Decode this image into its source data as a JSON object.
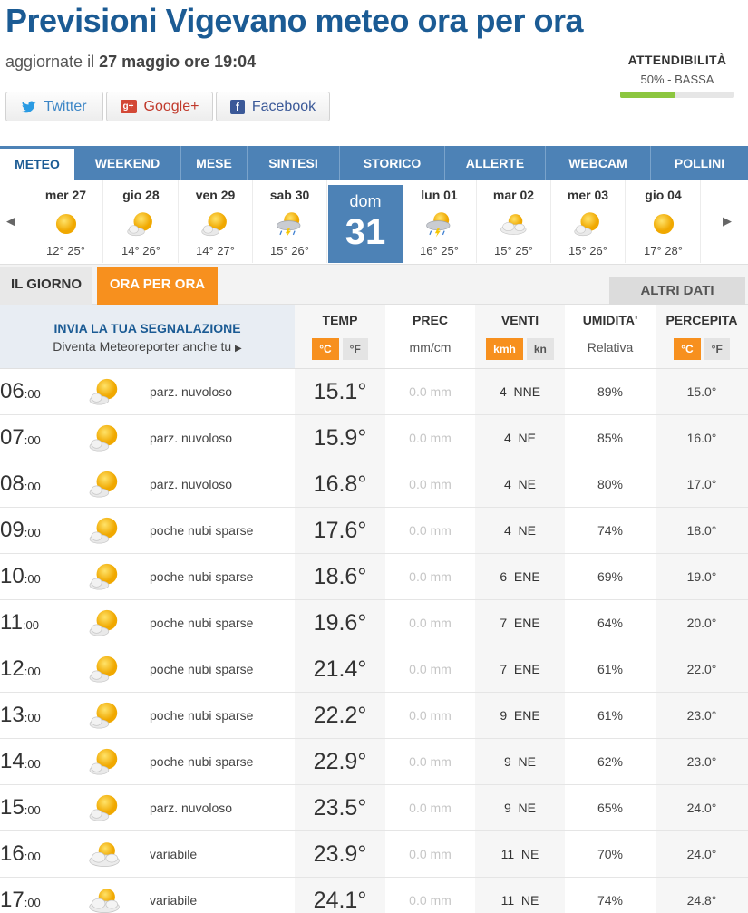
{
  "header": {
    "title": "Previsioni Vigevano meteo ora per ora",
    "updated_prefix": "aggiornate il",
    "updated_date": "27 maggio ore 19:04",
    "reliability_title": "ATTENDIBILITÀ",
    "reliability_value": "50% - BASSA",
    "reliability_fraction": 0.5
  },
  "social": {
    "twitter": "Twitter",
    "google": "Google+",
    "facebook": "Facebook"
  },
  "nav": [
    "METEO",
    "WEEKEND",
    "MESE",
    "SINTESI",
    "STORICO",
    "ALLERTE",
    "WEBCAM",
    "POLLINI"
  ],
  "days": [
    {
      "name": "mer 27",
      "temps": "12° 25°",
      "icon": "sun-icon"
    },
    {
      "name": "gio 28",
      "temps": "14° 26°",
      "icon": "sun-cloud-icon"
    },
    {
      "name": "ven 29",
      "temps": "14° 27°",
      "icon": "sun-cloud-icon"
    },
    {
      "name": "sab 30",
      "temps": "15° 26°",
      "icon": "thunderstorm-icon"
    },
    {
      "name": "dom",
      "number": "31",
      "selected": true
    },
    {
      "name": "lun 01",
      "temps": "16° 25°",
      "icon": "thunderstorm-icon"
    },
    {
      "name": "mar 02",
      "temps": "15° 25°",
      "icon": "cloud-sun-icon"
    },
    {
      "name": "mer 03",
      "temps": "15° 26°",
      "icon": "sun-cloud-icon"
    },
    {
      "name": "gio 04",
      "temps": "17° 28°",
      "icon": "sun-icon"
    }
  ],
  "subtabs": {
    "day": "IL GIORNO",
    "hourly": "ORA PER ORA",
    "other": "ALTRI DATI"
  },
  "table_header": {
    "report_title": "INVIA LA TUA SEGNALAZIONE",
    "report_sub": "Diventa Meteoreporter anche tu",
    "temp": "TEMP",
    "prec": "PREC",
    "prec_unit": "mm/cm",
    "wind": "VENTI",
    "humidity": "UMIDITA'",
    "humidity_sub": "Relativa",
    "perceived": "PERCEPITA",
    "unit_c": "°C",
    "unit_f": "°F",
    "unit_kmh": "kmh",
    "unit_kn": "kn"
  },
  "rows": [
    {
      "hour": "06",
      "min": ":00",
      "icon": "sun-cloud-icon",
      "desc": "parz. nuvoloso",
      "temp": "15.1°",
      "prec": "0.0 mm",
      "wind": "4  NNE",
      "hum": "89%",
      "perc": "15.0°"
    },
    {
      "hour": "07",
      "min": ":00",
      "icon": "sun-cloud-icon",
      "desc": "parz. nuvoloso",
      "temp": "15.9°",
      "prec": "0.0 mm",
      "wind": "4  NE",
      "hum": "85%",
      "perc": "16.0°"
    },
    {
      "hour": "08",
      "min": ":00",
      "icon": "sun-cloud-icon",
      "desc": "parz. nuvoloso",
      "temp": "16.8°",
      "prec": "0.0 mm",
      "wind": "4  NE",
      "hum": "80%",
      "perc": "17.0°"
    },
    {
      "hour": "09",
      "min": ":00",
      "icon": "sun-cloud-icon",
      "desc": "poche nubi sparse",
      "temp": "17.6°",
      "prec": "0.0 mm",
      "wind": "4  NE",
      "hum": "74%",
      "perc": "18.0°"
    },
    {
      "hour": "10",
      "min": ":00",
      "icon": "sun-cloud-icon",
      "desc": "poche nubi sparse",
      "temp": "18.6°",
      "prec": "0.0 mm",
      "wind": "6  ENE",
      "hum": "69%",
      "perc": "19.0°"
    },
    {
      "hour": "11",
      "min": ":00",
      "icon": "sun-cloud-icon",
      "desc": "poche nubi sparse",
      "temp": "19.6°",
      "prec": "0.0 mm",
      "wind": "7  ENE",
      "hum": "64%",
      "perc": "20.0°"
    },
    {
      "hour": "12",
      "min": ":00",
      "icon": "sun-cloud-icon",
      "desc": "poche nubi sparse",
      "temp": "21.4°",
      "prec": "0.0 mm",
      "wind": "7  ENE",
      "hum": "61%",
      "perc": "22.0°"
    },
    {
      "hour": "13",
      "min": ":00",
      "icon": "sun-cloud-icon",
      "desc": "poche nubi sparse",
      "temp": "22.2°",
      "prec": "0.0 mm",
      "wind": "9  ENE",
      "hum": "61%",
      "perc": "23.0°"
    },
    {
      "hour": "14",
      "min": ":00",
      "icon": "sun-cloud-icon",
      "desc": "poche nubi sparse",
      "temp": "22.9°",
      "prec": "0.0 mm",
      "wind": "9  NE",
      "hum": "62%",
      "perc": "23.0°"
    },
    {
      "hour": "15",
      "min": ":00",
      "icon": "sun-cloud-icon",
      "desc": "parz. nuvoloso",
      "temp": "23.5°",
      "prec": "0.0 mm",
      "wind": "9  NE",
      "hum": "65%",
      "perc": "24.0°"
    },
    {
      "hour": "16",
      "min": ":00",
      "icon": "cloud-sun-icon",
      "desc": "variabile",
      "temp": "23.9°",
      "prec": "0.0 mm",
      "wind": "11  NE",
      "hum": "70%",
      "perc": "24.0°"
    },
    {
      "hour": "17",
      "min": ":00",
      "icon": "cloud-sun-icon",
      "desc": "variabile",
      "temp": "24.1°",
      "prec": "0.0 mm",
      "wind": "11  NE",
      "hum": "74%",
      "perc": "24.8°"
    }
  ],
  "colors": {
    "brand_blue": "#1b5b94",
    "nav_blue": "#4d82b6",
    "accent_orange": "#f7901e",
    "reliability_green": "#8cc63f"
  }
}
